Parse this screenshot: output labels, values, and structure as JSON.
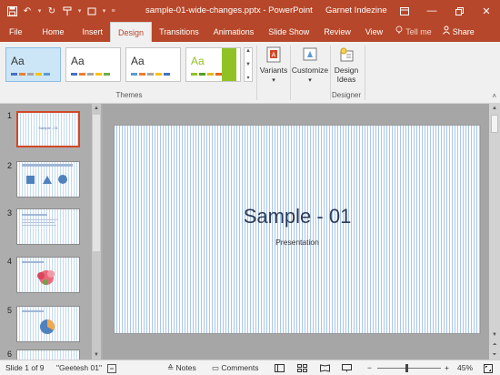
{
  "titlebar": {
    "title": "sample-01-wide-changes.pptx - PowerPoint",
    "user": "Garnet Indezine",
    "qat_icons": [
      "save-icon",
      "undo-icon",
      "redo-icon",
      "format-painter-icon",
      "new-slide-icon",
      "customize-qat-icon"
    ],
    "window_icons": [
      "ribbon-display-icon",
      "minimize-icon",
      "restore-icon",
      "close-icon"
    ]
  },
  "tabs": [
    {
      "label": "File"
    },
    {
      "label": "Home"
    },
    {
      "label": "Insert"
    },
    {
      "label": "Design",
      "active": true
    },
    {
      "label": "Transitions"
    },
    {
      "label": "Animations"
    },
    {
      "label": "Slide Show"
    },
    {
      "label": "Review"
    },
    {
      "label": "View"
    }
  ],
  "tellme": "Tell me",
  "share": "Share",
  "ribbon": {
    "themes_label": "Themes",
    "theme_sample": "Aa",
    "variants_label": "Variants",
    "customize_label": "Customize",
    "design_ideas_line1": "Design",
    "design_ideas_line2": "Ideas",
    "designer_label": "Designer"
  },
  "thumbnails": [
    {
      "number": "1",
      "title": "Sample - 01"
    },
    {
      "number": "2"
    },
    {
      "number": "3"
    },
    {
      "number": "4"
    },
    {
      "number": "5"
    },
    {
      "number": "6"
    }
  ],
  "slide": {
    "title": "Sample - 01",
    "subtitle": "Presentation"
  },
  "status": {
    "slide_info": "Slide 1 of 9",
    "theme_name": "\"Geetesh 01\"",
    "notes": "Notes",
    "comments": "Comments",
    "zoom": "45%"
  },
  "colors": {
    "accent": "#b7472a",
    "selected_thumb_border": "#d24726"
  }
}
